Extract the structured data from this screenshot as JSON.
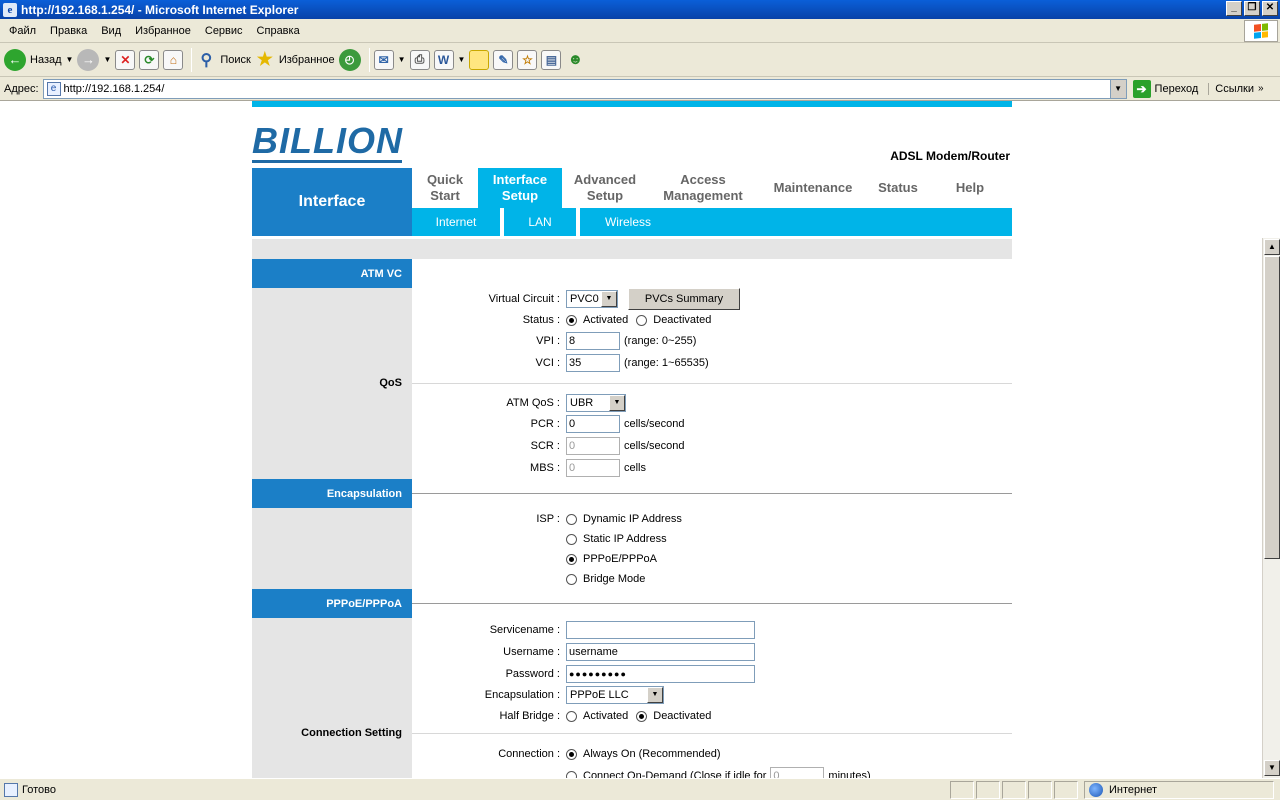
{
  "window": {
    "title": "http://192.168.1.254/ - Microsoft Internet Explorer",
    "controls": [
      "_",
      "❐",
      "✕"
    ]
  },
  "menu": [
    "Файл",
    "Правка",
    "Вид",
    "Избранное",
    "Сервис",
    "Справка"
  ],
  "toolbar": {
    "back_label": "Назад",
    "search_label": "Поиск",
    "favorites_label": "Избранное"
  },
  "address": {
    "label": "Адрес:",
    "url": "http://192.168.1.254/",
    "go_label": "Переход",
    "links_label": "Ссылки"
  },
  "status": {
    "text": "Готово",
    "zone": "Интернет"
  },
  "router": {
    "brand": "BILLION",
    "product": "ADSL Modem/Router",
    "section_title": "Interface",
    "nav": [
      {
        "label": "Quick\nStart",
        "active": false
      },
      {
        "label": "Interface\nSetup",
        "active": true
      },
      {
        "label": "Advanced\nSetup",
        "active": false
      },
      {
        "label": "Access\nManagement",
        "active": false
      },
      {
        "label": "Maintenance",
        "active": false
      },
      {
        "label": "Status",
        "active": false
      },
      {
        "label": "Help",
        "active": false
      }
    ],
    "subnav": [
      "Internet",
      "LAN",
      "Wireless"
    ],
    "sections": {
      "atm_vc": "ATM VC",
      "qos": "QoS",
      "encapsulation": "Encapsulation",
      "pppoe": "PPPoE/PPPoA",
      "connection": "Connection Setting"
    },
    "atm": {
      "vc_label": "Virtual Circuit :",
      "vc_value": "PVC0",
      "pvc_summary_button": "PVCs Summary",
      "status_label": "Status :",
      "status_activated": "Activated",
      "status_deactivated": "Deactivated",
      "vpi_label": "VPI :",
      "vpi_value": "8",
      "vpi_range": "(range: 0~255)",
      "vci_label": "VCI :",
      "vci_value": "35",
      "vci_range": "(range: 1~65535)"
    },
    "qos": {
      "atm_qos_label": "ATM QoS :",
      "atm_qos_value": "UBR",
      "pcr_label": "PCR :",
      "pcr_value": "0",
      "scr_label": "SCR :",
      "scr_value": "0",
      "mbs_label": "MBS :",
      "mbs_value": "0",
      "cells_per_second": "cells/second",
      "cells": "cells"
    },
    "isp": {
      "label": "ISP :",
      "options": [
        "Dynamic IP Address",
        "Static IP Address",
        "PPPoE/PPPoA",
        "Bridge Mode"
      ],
      "selected": 2
    },
    "pppoe": {
      "servicename_label": "Servicename :",
      "servicename_value": "",
      "username_label": "Username :",
      "username_value": "username",
      "password_label": "Password :",
      "password_value": "●●●●●●●●●",
      "encap_label": "Encapsulation :",
      "encap_value": "PPPoE LLC",
      "halfbridge_label": "Half Bridge :",
      "halfbridge_activated": "Activated",
      "halfbridge_deactivated": "Deactivated"
    },
    "connection": {
      "label": "Connection :",
      "always_on": "Always On (Recommended)",
      "on_demand": "Connect On-Demand (Close if idle for",
      "idle_value": "0",
      "minutes": "minutes)"
    }
  }
}
